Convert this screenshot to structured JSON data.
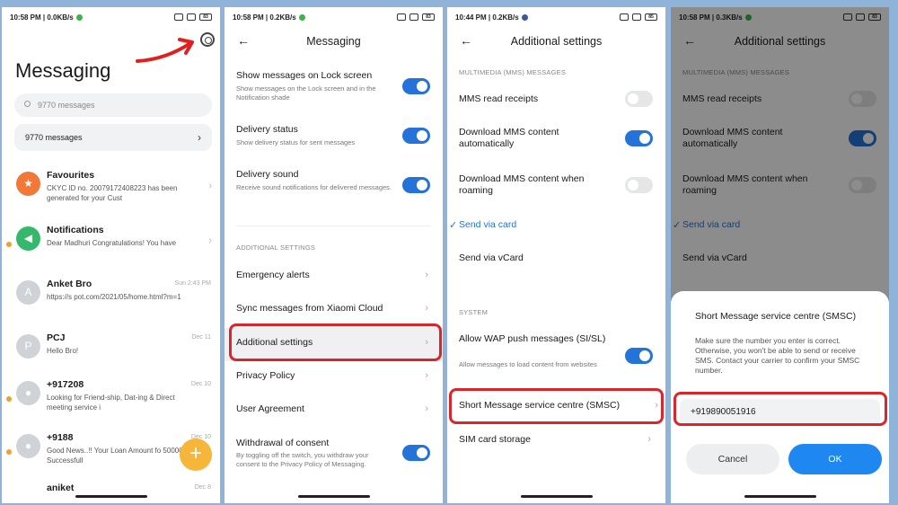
{
  "colors": {
    "accent": "#2573d8",
    "highlight": "#d9262c",
    "fab": "#f5b63a",
    "background": "#8fb3d9"
  },
  "screen1": {
    "status_time": "10:58 PM | 0.0KB/s",
    "battery": "83",
    "title": "Messaging",
    "search_placeholder": "9770 messages",
    "all_messages": "9770 messages",
    "conversations": [
      {
        "name": "Favourites",
        "snippet": "CKYC ID no. 20079172408223 has been generated for your Cust",
        "time": "",
        "avatar": "★",
        "avatar_color": "#f07838",
        "unread": false
      },
      {
        "name": "Notifications",
        "snippet": "Dear Madhuri Congratulations! You have",
        "time": "",
        "avatar": "◀",
        "avatar_color": "#35b86b",
        "unread": true
      },
      {
        "name": "Anket Bro",
        "snippet": "https://s                         pot.com/2021/05/home.html?m=1",
        "time": "Sun 2:43 PM",
        "avatar": "A",
        "avatar_color": "#cfd3d8",
        "unread": false
      },
      {
        "name": "PCJ",
        "snippet": "Hello Bro!",
        "time": "Dec 11",
        "avatar": "P",
        "avatar_color": "#cfd3d8",
        "unread": false
      },
      {
        "name": "+917208",
        "snippet": "Looking for Friend-ship, Dat-ing & Direct meeting service i",
        "time": "Dec 10",
        "avatar": "●",
        "avatar_color": "#cfd3d8",
        "unread": true
      },
      {
        "name": "+9188",
        "snippet": "Good News..!! Your Loan Amount fo 500000 Is Successfull",
        "time": "Dec 10",
        "avatar": "●",
        "avatar_color": "#cfd3d8",
        "unread": true
      },
      {
        "name": "aniket",
        "snippet": "",
        "time": "Dec 8",
        "avatar": "",
        "avatar_color": "#ffffff",
        "unread": false
      }
    ]
  },
  "screen2": {
    "status_time": "10:58 PM | 0.2KB/s",
    "battery": "83",
    "title": "Messaging",
    "items": [
      {
        "title": "Show messages on Lock screen",
        "sub": "Show messages on the Lock screen and in the Notification shade"
      },
      {
        "title": "Delivery status",
        "sub": "Show delivery status for sent messages"
      },
      {
        "title": "Delivery sound",
        "sub": "Receive sound notifications for delivered messages."
      }
    ],
    "section": "ADDITIONAL SETTINGS",
    "links": [
      "Emergency alerts",
      "Sync messages from Xiaomi Cloud",
      "Additional settings",
      "Privacy Policy",
      "User Agreement"
    ],
    "withdrawal": {
      "title": "Withdrawal of consent",
      "sub": "By toggling off the switch, you withdraw your consent to the Privacy Policy of Messaging."
    }
  },
  "screen3": {
    "status_time": "10:44 PM | 0.2KB/s",
    "battery": "85",
    "title": "Additional settings",
    "mms_section": "MULTIMEDIA (MMS) MESSAGES",
    "mms_read": "MMS read receipts",
    "download_auto": "Download MMS content automatically",
    "download_roaming": "Download MMS content when roaming",
    "send_card": "Send via card",
    "send_vcard": "Send via vCard",
    "system_section": "SYSTEM",
    "wap": {
      "title": "Allow WAP push messages (SI/SL)",
      "sub": "Allow messages to load content from websites"
    },
    "smsc": "Short Message service centre (SMSC)",
    "sim": "SIM card storage"
  },
  "screen4": {
    "status_time": "10:58 PM | 0.3KB/s",
    "battery": "83",
    "dialog": {
      "title": "Short Message service centre (SMSC)",
      "body": "Make sure the number you enter is correct. Otherwise, you won't be able to send or receive SMS. Contact your carrier to confirm your SMSC number.",
      "value": "+919890051916",
      "cancel": "Cancel",
      "ok": "OK"
    }
  }
}
